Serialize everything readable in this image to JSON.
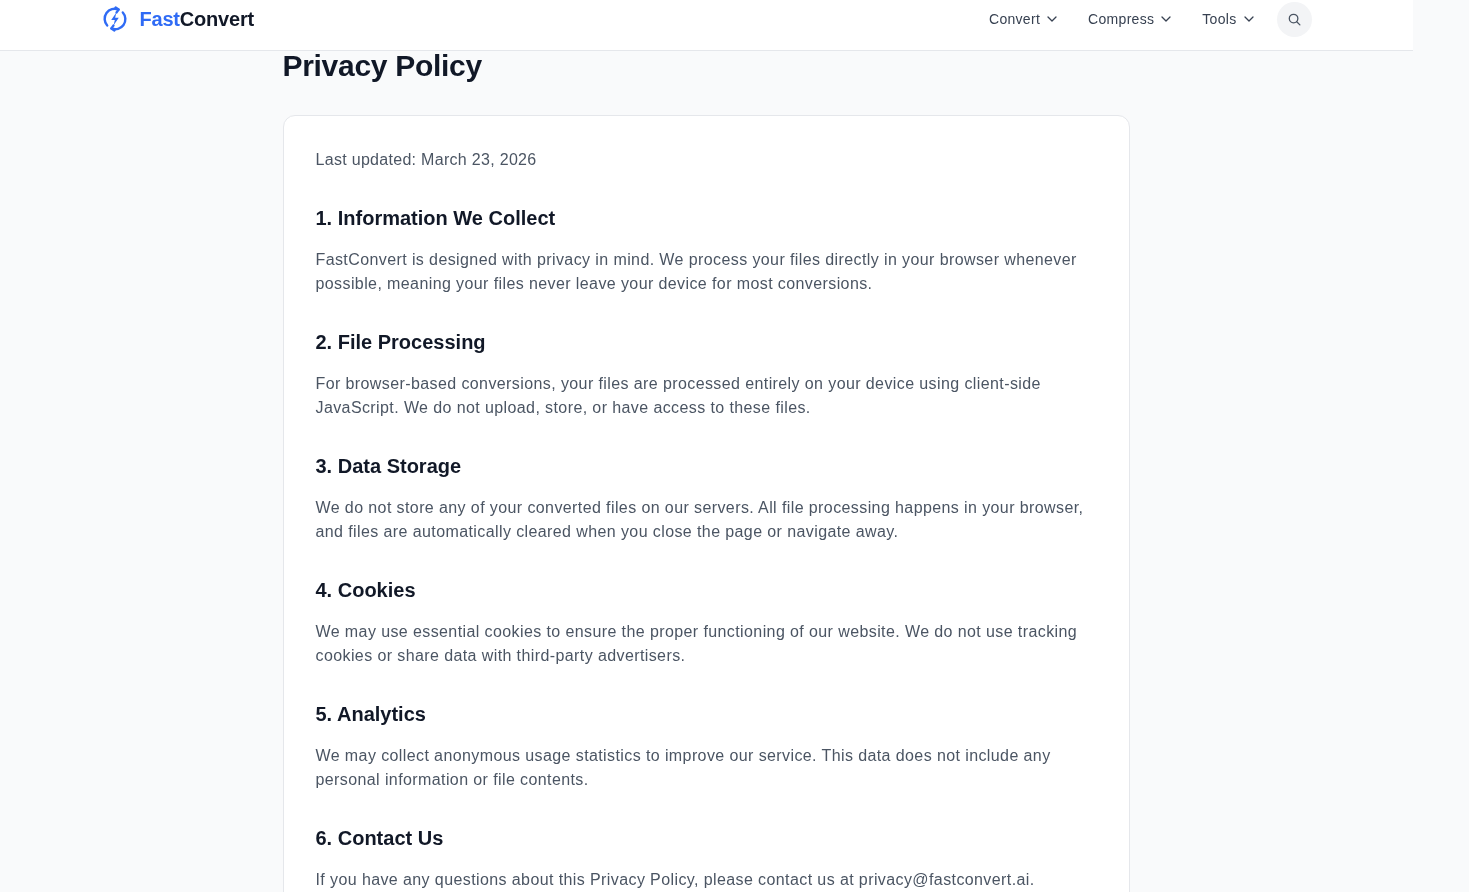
{
  "header": {
    "brand": {
      "accent": "Fast",
      "rest": "Convert"
    },
    "nav": [
      {
        "label": "Convert"
      },
      {
        "label": "Compress"
      },
      {
        "label": "Tools"
      }
    ]
  },
  "page": {
    "title": "Privacy Policy",
    "last_updated": "Last updated: March 23, 2026",
    "sections": [
      {
        "heading": "1. Information We Collect",
        "body": "FastConvert is designed with privacy in mind. We process your files directly in your browser whenever possible, meaning your files never leave your device for most conversions."
      },
      {
        "heading": "2. File Processing",
        "body": "For browser-based conversions, your files are processed entirely on your device using client-side JavaScript. We do not upload, store, or have access to these files."
      },
      {
        "heading": "3. Data Storage",
        "body": "We do not store any of your converted files on our servers. All file processing happens in your browser, and files are automatically cleared when you close the page or navigate away."
      },
      {
        "heading": "4. Cookies",
        "body": "We may use essential cookies to ensure the proper functioning of our website. We do not use tracking cookies or share data with third-party advertisers."
      },
      {
        "heading": "5. Analytics",
        "body": "We may collect anonymous usage statistics to improve our service. This data does not include any personal information or file contents."
      },
      {
        "heading": "6. Contact Us",
        "body": "If you have any questions about this Privacy Policy, please contact us at privacy@fastconvert.ai."
      }
    ]
  }
}
